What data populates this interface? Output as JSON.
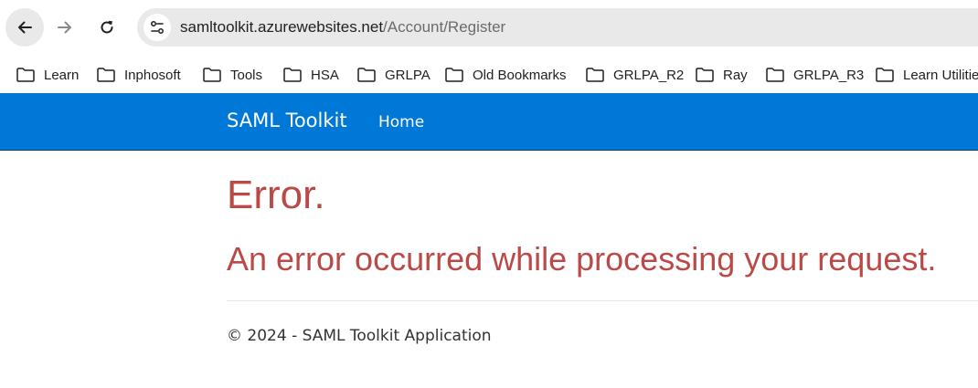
{
  "browser": {
    "address_bar": {
      "host": "samltoolkit.azurewebsites.net",
      "path": "/Account/Register"
    },
    "bookmarks": [
      {
        "label": "Learn"
      },
      {
        "label": "Inphosoft"
      },
      {
        "label": "Tools"
      },
      {
        "label": "HSA"
      },
      {
        "label": "GRLPA"
      },
      {
        "label": "Old Bookmarks"
      },
      {
        "label": "GRLPA_R2"
      },
      {
        "label": "Ray"
      },
      {
        "label": "GRLPA_R3"
      },
      {
        "label": "Learn Utilitie"
      }
    ],
    "icons": {
      "back": "arrow-left-icon",
      "forward": "arrow-right-icon",
      "reload": "reload-icon",
      "site_info": "site-settings-icon",
      "bookmark": "folder-icon"
    }
  },
  "navbar": {
    "brand": "SAML Toolkit",
    "links": [
      {
        "label": "Home"
      }
    ],
    "color": "#0078d7"
  },
  "main": {
    "title": "Error.",
    "message": "An error occurred while processing your request.",
    "error_color": "#b94a48"
  },
  "footer": {
    "text": "© 2024 - SAML Toolkit Application"
  }
}
